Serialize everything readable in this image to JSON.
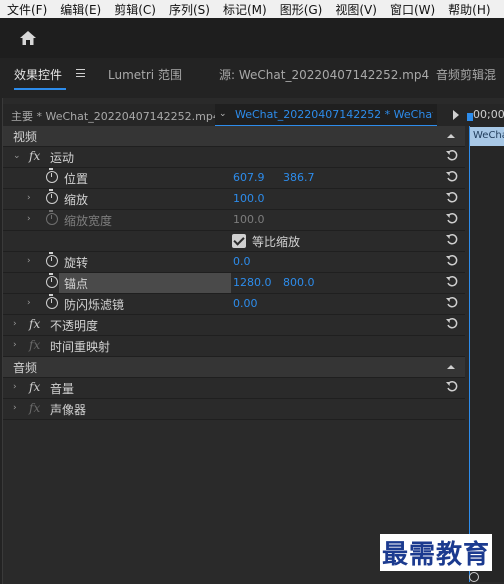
{
  "menu": [
    "文件(F)",
    "编辑(E)",
    "剪辑(C)",
    "序列(S)",
    "标记(M)",
    "图形(G)",
    "视图(V)",
    "窗口(W)",
    "帮助(H)"
  ],
  "tabs": {
    "effect_controls": "效果控件",
    "lumetri": "Lumetri 范围",
    "source": "源: WeChat_20220407142252.mp4",
    "audio_mixer": "音频剪辑混"
  },
  "clipbar": {
    "master": "主要 * WeChat_20220407142252.mp4",
    "sequence": "WeChat_20220407142252 * WeChat_2...",
    "timecode": "00;00"
  },
  "timeline_clip": "WeCha",
  "sections": {
    "video": "视频",
    "audio": "音频"
  },
  "effects": {
    "motion": "运动",
    "position": {
      "label": "位置",
      "x": "607.9",
      "y": "386.7"
    },
    "scale": {
      "label": "缩放",
      "value": "100.0"
    },
    "scale_width": {
      "label": "缩放宽度",
      "value": "100.0"
    },
    "uniform_scale": "等比缩放",
    "rotation": {
      "label": "旋转",
      "value": "0.0"
    },
    "anchor": {
      "label": "锚点",
      "x": "1280.0",
      "y": "800.0"
    },
    "anti_flicker": {
      "label": "防闪烁滤镜",
      "value": "0.00"
    },
    "opacity": "不透明度",
    "time_remap": "时间重映射",
    "volume": "音量",
    "panner": "声像器"
  },
  "watermark": "最需教育",
  "colors": {
    "accent": "#2d8ceb",
    "panel": "#2a2a2a",
    "section": "#353535"
  }
}
